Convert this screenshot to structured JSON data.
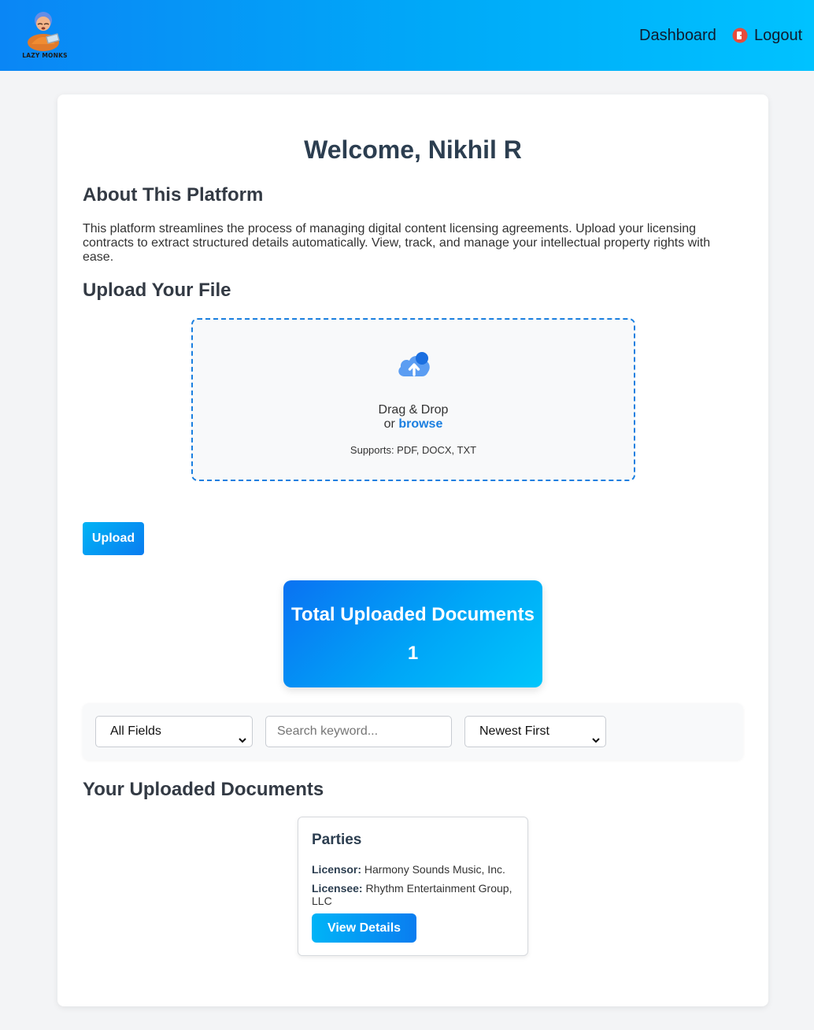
{
  "header": {
    "logo_text": "LAZY MONKS",
    "nav": {
      "dashboard": "Dashboard",
      "logout": "Logout"
    }
  },
  "main": {
    "welcome": "Welcome, Nikhil R",
    "about": {
      "heading": "About This Platform",
      "text": "This platform streamlines the process of managing digital content licensing agreements. Upload your licensing contracts to extract structured details automatically. View, track, and manage your intellectual property rights with ease."
    },
    "upload": {
      "heading": "Upload Your File",
      "drag_text": "Drag & Drop",
      "or_text": "or",
      "browse_text": "browse",
      "supports": "Supports: PDF, DOCX, TXT",
      "button_label": "Upload"
    },
    "stats": {
      "title": "Total Uploaded Documents",
      "count": "1"
    },
    "filters": {
      "field_selected": "All Fields",
      "search_placeholder": "Search keyword...",
      "sort_selected": "Newest First"
    },
    "documents": {
      "heading": "Your Uploaded Documents",
      "items": [
        {
          "title": "Parties",
          "licensor_label": "Licensor:",
          "licensor": "Harmony Sounds Music, Inc.",
          "licensee_label": "Licensee:",
          "licensee": "Rhythm Entertainment Group, LLC",
          "button_label": "View Details"
        }
      ]
    }
  },
  "colors": {
    "header_gradient_start": "#0a86f5",
    "header_gradient_end": "#00c2ff",
    "accent": "#1a7fe0",
    "logout_icon": "#e74c3c"
  },
  "icons": {
    "logo": "monk-with-laptop-logo",
    "logout": "logout-icon",
    "upload": "cloud-upload-icon"
  }
}
